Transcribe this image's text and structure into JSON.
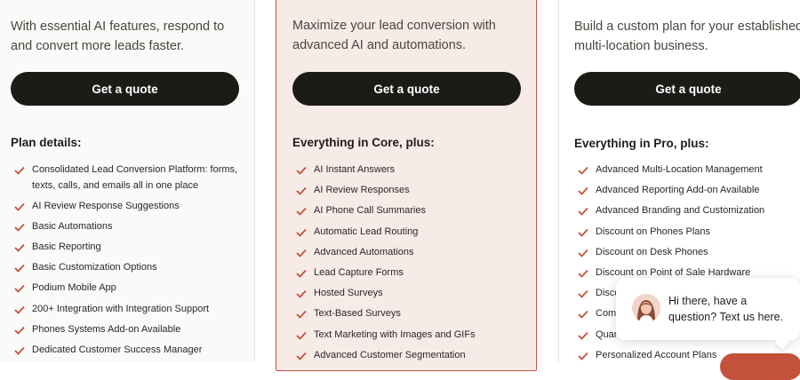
{
  "plans": [
    {
      "description": "With essential AI features, respond to and convert more leads faster.",
      "button_label": "Get a quote",
      "features_heading": "Plan details:",
      "features": [
        "Consolidated Lead Conversion Platform: forms, texts, calls, and emails all in one place",
        "AI Review Response Suggestions",
        "Basic Automations",
        "Basic Reporting",
        "Basic Customization Options",
        "Podium Mobile App",
        "200+ Integration with Integration Support",
        "Phones Systems Add-on Available",
        "Dedicated Customer Success Manager"
      ]
    },
    {
      "description": "Maximize your lead conversion with advanced AI and automations.",
      "button_label": "Get a quote",
      "features_heading": "Everything in Core, plus:",
      "features": [
        "AI Instant Answers",
        "AI Review Responses",
        "AI Phone Call Summaries",
        "Automatic Lead Routing",
        "Advanced Automations",
        "Lead Capture Forms",
        "Hosted Surveys",
        "Text-Based Surveys",
        "Text Marketing with Images and GIFs",
        "Advanced Customer Segmentation"
      ]
    },
    {
      "description": "Build a custom plan for your established, multi-location business.",
      "button_label": "Get a quote",
      "features_heading": "Everything in Pro, plus:",
      "features": [
        "Advanced Multi-Location Management",
        "Advanced Reporting Add-on Available",
        "Advanced Branding and Customization",
        "Discount on Phones Plans",
        "Discount on Desk Phones",
        "Discount on Point of Sale Hardware",
        "Disco",
        "Com",
        "Quar",
        "Personalized Account Plans"
      ]
    }
  ],
  "chat_popup": {
    "message": "Hi there, have a question? Text us here."
  },
  "colors": {
    "accent": "#c4513a",
    "button_bg": "#1d1b18",
    "highlight_card_bg": "#f7ebe7"
  },
  "icons": {
    "feature_bullet": "checkmark-icon",
    "chat_avatar": "avatar"
  }
}
